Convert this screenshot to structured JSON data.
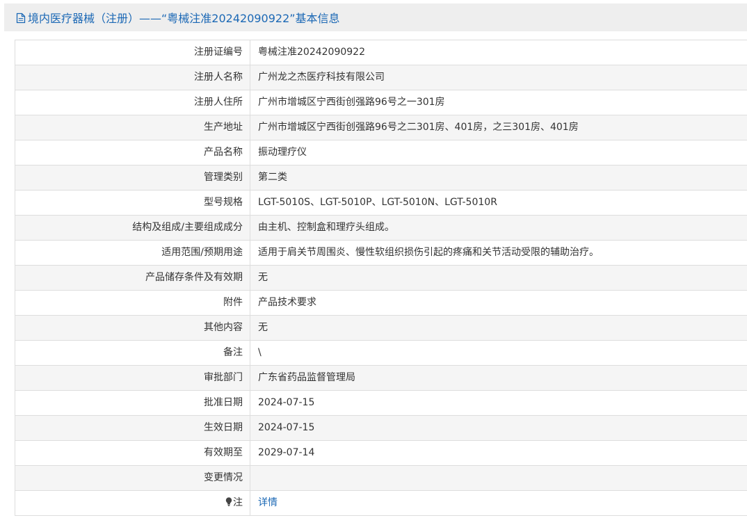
{
  "header": {
    "title": "境内医疗器械（注册）——“粤械注准20242090922”基本信息",
    "icon": "document-icon",
    "color": "#1b68b5"
  },
  "rows": [
    {
      "label": "注册证编号",
      "value": "粤械注准20242090922"
    },
    {
      "label": "注册人名称",
      "value": "广州龙之杰医疗科技有限公司"
    },
    {
      "label": "注册人住所",
      "value": "广州市增城区宁西街创强路96号之一301房"
    },
    {
      "label": "生产地址",
      "value": "广州市增城区宁西街创强路96号之二301房、401房，之三301房、401房"
    },
    {
      "label": "产品名称",
      "value": "振动理疗仪"
    },
    {
      "label": "管理类别",
      "value": "第二类"
    },
    {
      "label": "型号规格",
      "value": "LGT-5010S、LGT-5010P、LGT-5010N、LGT-5010R"
    },
    {
      "label": "结构及组成/主要组成成分",
      "value": "由主机、控制盒和理疗头组成。"
    },
    {
      "label": "适用范围/预期用途",
      "value": "适用于肩关节周围炎、慢性软组织损伤引起的疼痛和关节活动受限的辅助治疗。"
    },
    {
      "label": "产品储存条件及有效期",
      "value": "无"
    },
    {
      "label": "附件",
      "value": "产品技术要求"
    },
    {
      "label": "其他内容",
      "value": "无"
    },
    {
      "label": "备注",
      "value": "\\"
    },
    {
      "label": "审批部门",
      "value": "广东省药品监督管理局"
    },
    {
      "label": "批准日期",
      "value": "2024-07-15"
    },
    {
      "label": "生效日期",
      "value": "2024-07-15"
    },
    {
      "label": "有效期至",
      "value": "2029-07-14"
    },
    {
      "label": "变更情况",
      "value": ""
    }
  ],
  "note_row": {
    "label": "注",
    "icon": "lightbulb-icon",
    "link_text": "详情"
  }
}
